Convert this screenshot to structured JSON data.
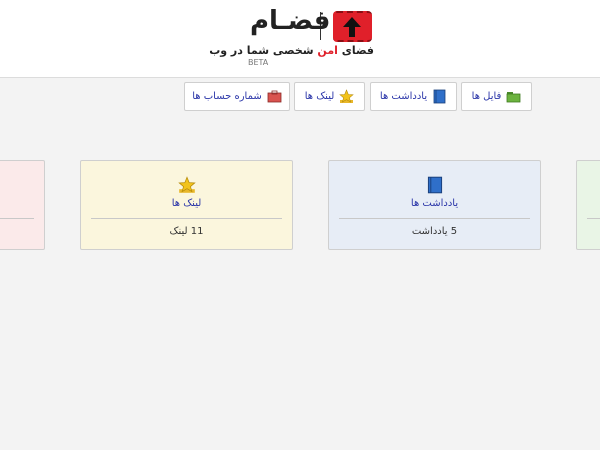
{
  "header": {
    "brand_name": "فضـام",
    "tagline_prefix": "فضای ",
    "tagline_accent": "امن",
    "tagline_suffix": " شخصی شما در وب",
    "beta": "BETA",
    "accent_color": "#e0202a"
  },
  "nav": {
    "tabs": [
      {
        "label": "فایل ها",
        "icon": "folder-icon"
      },
      {
        "label": "یادداشت ها",
        "icon": "notebook-icon"
      },
      {
        "label": "لینک ها",
        "icon": "star-icon"
      },
      {
        "label": "شماره حساب ها",
        "icon": "wallet-icon"
      }
    ],
    "link_color": "#2a35a8"
  },
  "cards": {
    "links": {
      "title": "لینک ها",
      "count": "11 لینک",
      "icon": "star-icon",
      "bg": "#fbf6dd"
    },
    "notes": {
      "title": "یادداشت ها",
      "count": "5 یادداشت",
      "icon": "notebook-icon",
      "bg": "#e7edf6"
    }
  }
}
